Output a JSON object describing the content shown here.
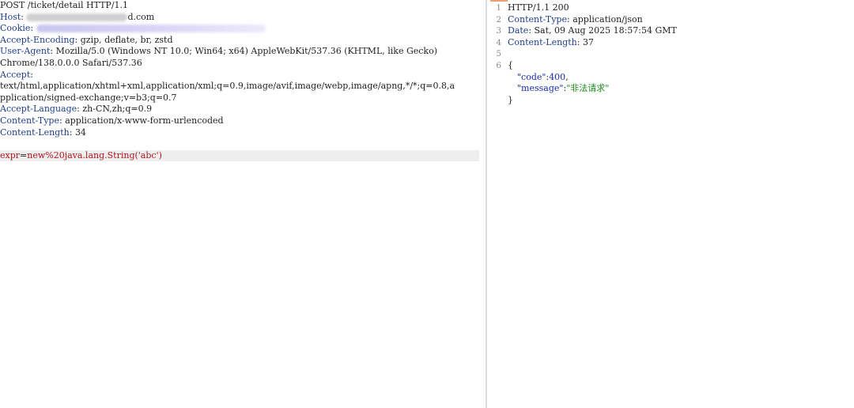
{
  "request": {
    "request_line": "POST /ticket/detail HTTP/1.1",
    "headers": [
      {
        "name": "Host",
        "value_visible": "d.com"
      },
      {
        "name": "Cookie",
        "value_visible": ""
      },
      {
        "name": "Accept-Encoding",
        "value_visible": "gzip, deflate, br, zstd"
      },
      {
        "name": "User-Agent",
        "value_visible": "Mozilla/5.0 (Windows NT 10.0; Win64; x64) AppleWebKit/537.36 (KHTML, like Gecko)"
      },
      {
        "name": "Accept",
        "value_visible": ""
      },
      {
        "name": "Accept-Language",
        "value_visible": "zh-CN,zh;q=0.9"
      },
      {
        "name": "Content-Type",
        "value_visible": "application/x-www-form-urlencoded"
      },
      {
        "name": "Content-Length",
        "value_visible": "34"
      }
    ],
    "user_agent_cont": "Chrome/138.0.0.0 Safari/537.36",
    "accept_value_line1": "text/html,application/xhtml+xml,application/xml;q=0.9,image/avif,image/webp,image/apng,*/*;q=0.8,a",
    "accept_value_line2": "pplication/signed-exchange;v=b3;q=0.7",
    "body": {
      "key": "expr",
      "eq": "=",
      "value": "new%20java.lang.String('abc')"
    }
  },
  "response": {
    "line_numbers": [
      "1",
      "2",
      "3",
      "4",
      "5",
      "6"
    ],
    "status_line": "HTTP/1.1 200",
    "headers": [
      {
        "name": "Content-Type",
        "value": "application/json"
      },
      {
        "name": "Date",
        "value": "Sat, 09 Aug 2025 18:57:54 GMT"
      },
      {
        "name": "Content-Length",
        "value": "37"
      }
    ],
    "json": {
      "open": "{",
      "code_key": "\"code\"",
      "code_value": "400",
      "message_key": "\"message\"",
      "message_value": "\"非法请求\"",
      "close": "}"
    }
  },
  "colors": {
    "header_name": "#1f3f8a",
    "body_param": "#b0171f",
    "json_key": "#1a2aa8",
    "json_string": "#1b8a1b",
    "line_number": "#8a8a8a"
  }
}
